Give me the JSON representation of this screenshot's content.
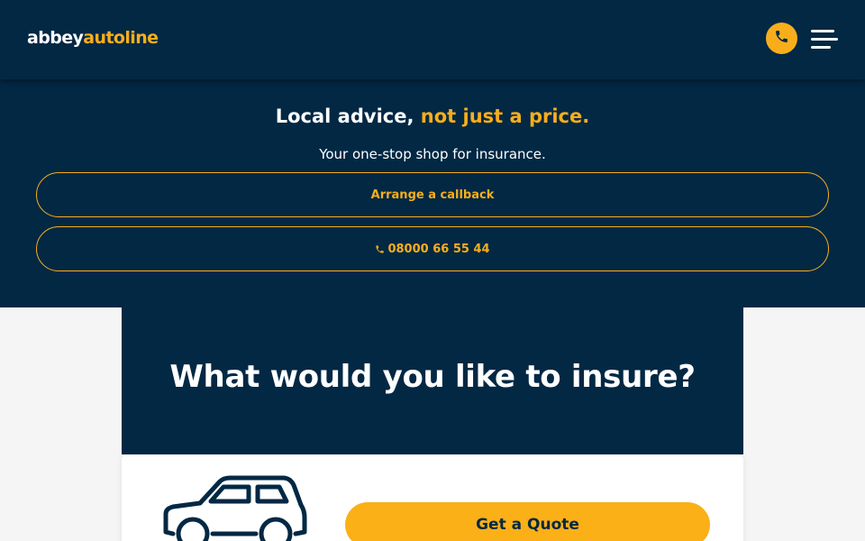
{
  "header": {
    "logo_part1": "abbey",
    "logo_part2": "autoline",
    "phone_icon": "phone-icon",
    "menu_icon": "hamburger-menu-icon"
  },
  "hero": {
    "title_main": "Local advice, ",
    "title_accent": "not just a price.",
    "subtitle": "Your one-stop shop for insurance.",
    "callback_label": "Arrange a callback",
    "phone_label": "08000 66 55 44"
  },
  "insure": {
    "title": "What would you like to insure?",
    "card": {
      "icon": "car-icon",
      "button_label": "Get a Quote"
    }
  },
  "colors": {
    "navy": "#022844",
    "accent": "#f8ae1b",
    "background": "#f5f5f5",
    "white": "#ffffff"
  }
}
